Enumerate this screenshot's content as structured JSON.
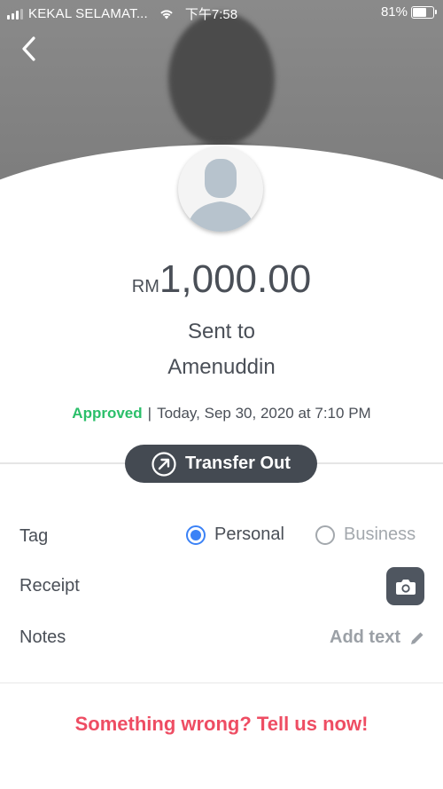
{
  "status_bar": {
    "carrier": "KEKAL SELAMAT...",
    "time": "下午7:58",
    "battery_text": "81%",
    "battery_level": 0.81,
    "signal_bars": 3
  },
  "header": {
    "back_icon": "chevron-left-icon"
  },
  "transaction": {
    "currency": "RM",
    "amount": "1,000.00",
    "sent_to_label": "Sent to",
    "recipient": "Amenuddin",
    "status": "Approved",
    "separator": "|",
    "datetime": "Today, Sep 30, 2020 at 7:10 PM",
    "type_label": "Transfer Out",
    "type_icon": "arrow-up-right-circle-icon"
  },
  "details": {
    "tag_label": "Tag",
    "tag_options": [
      {
        "label": "Personal",
        "selected": true
      },
      {
        "label": "Business",
        "selected": false
      }
    ],
    "receipt_label": "Receipt",
    "receipt_icon": "camera-icon",
    "notes_label": "Notes",
    "notes_action": "Add text",
    "notes_icon": "pencil-icon"
  },
  "footer": {
    "report_link": "Something wrong? Tell us now!"
  },
  "colors": {
    "approved": "#2bbf6a",
    "report": "#ee4d63",
    "radio_selected": "#3b82f6",
    "dark_pill": "#444a52"
  }
}
